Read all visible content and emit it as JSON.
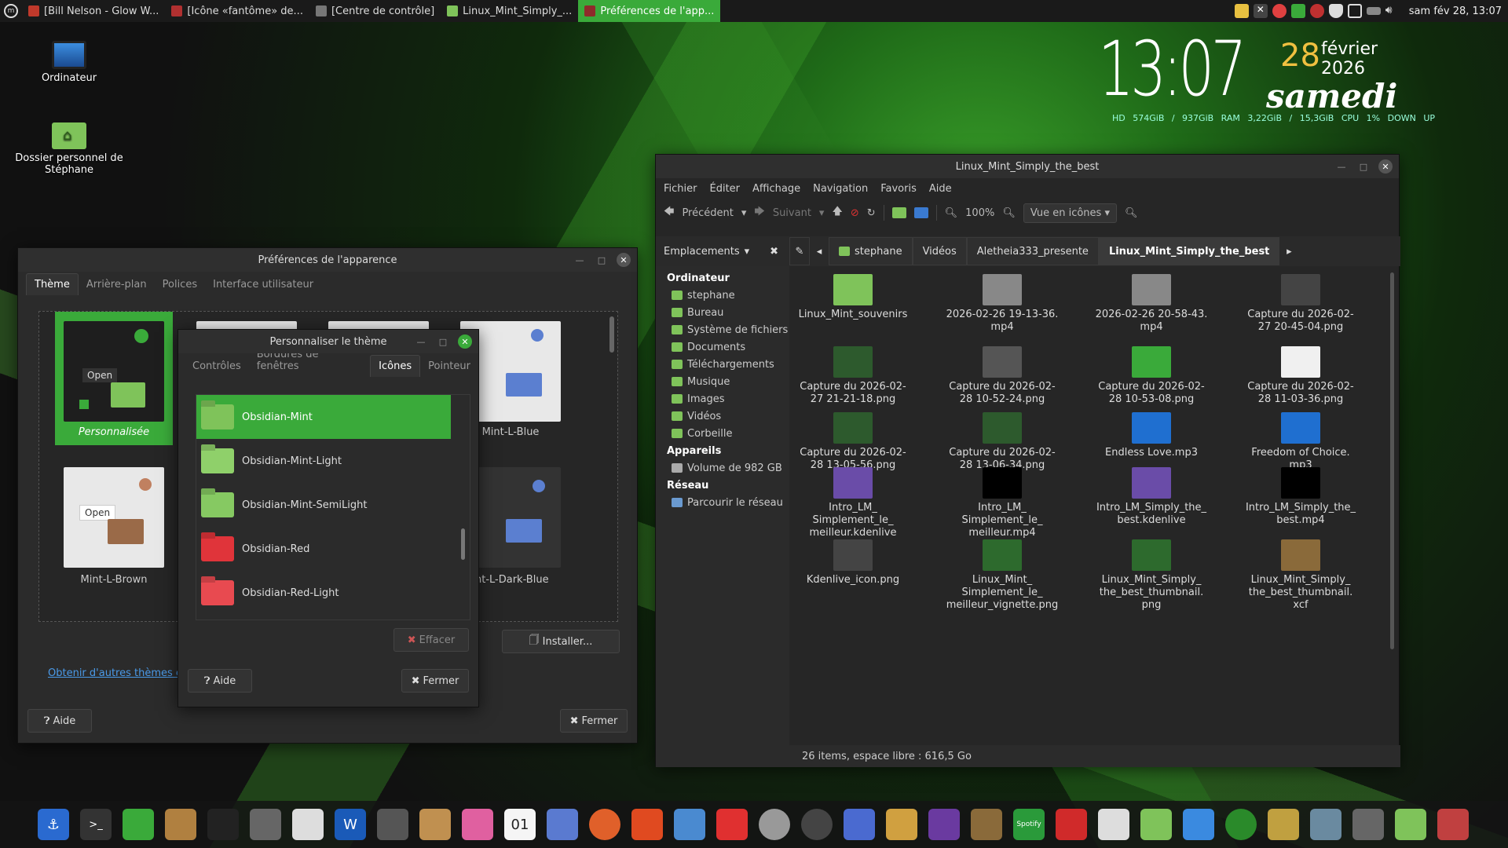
{
  "topbar": {
    "tasks": [
      {
        "label": "[Bill Nelson - Glow W...",
        "color": "#c0392b"
      },
      {
        "label": "[Icône «fantôme» de...",
        "color": "#b03030"
      },
      {
        "label": "[Centre de contrôle]",
        "color": "#777777"
      },
      {
        "label": "Linux_Mint_Simply_...",
        "color": "#7fc35a"
      },
      {
        "label": "Préférences de l'app...",
        "color": "#8e2b2b"
      }
    ],
    "clock": "sam fév 28, 13:07"
  },
  "desktop": {
    "icons": [
      {
        "label": "Ordinateur"
      },
      {
        "label": "Dossier personnel de Stéphane"
      }
    ]
  },
  "conky": {
    "time": "13:07",
    "day": "28",
    "month": "février 2026",
    "weekday": "samedi",
    "stats": "HD 574GiB / 937GiB   RAM 3,22GiB / 15,3GiB   CPU 1%   DOWN   UP"
  },
  "appearance": {
    "title": "Préférences de l'apparence",
    "tabs": [
      "Thème",
      "Arrière-plan",
      "Polices",
      "Interface utilisateur"
    ],
    "themes": [
      "Personnalisée",
      "Mint-L-Blue",
      "Mint-L-Brown",
      "int-L-Dark-Blue"
    ],
    "open_label": "Open",
    "install_label": "Installer...",
    "link_label": "Obtenir d'autres thèmes en",
    "help_label": "Aide",
    "close_label": "Fermer"
  },
  "theme_dialog": {
    "title": "Personnaliser le thème",
    "tabs": [
      "Contrôles",
      "Bordures de fenêtres",
      "Icônes",
      "Pointeur"
    ],
    "items": [
      {
        "label": "Obsidian-Mint",
        "color": "#7fc35a"
      },
      {
        "label": "Obsidian-Mint-Light",
        "color": "#8fd06a"
      },
      {
        "label": "Obsidian-Mint-SemiLight",
        "color": "#86c962"
      },
      {
        "label": "Obsidian-Red",
        "color": "#e0343a"
      },
      {
        "label": "Obsidian-Red-Light",
        "color": "#e84a50"
      }
    ],
    "clear_label": "Effacer",
    "help_label": "Aide",
    "close_label": "Fermer"
  },
  "filemanager": {
    "title": "Linux_Mint_Simply_the_best",
    "menu": [
      "Fichier",
      "Éditer",
      "Affichage",
      "Navigation",
      "Favoris",
      "Aide"
    ],
    "back_label": "Précédent",
    "forward_label": "Suivant",
    "zoom": "100%",
    "view_label": "Vue en icônes",
    "places_label": "Emplacements",
    "breadcrumbs": [
      "stephane",
      "Vidéos",
      "Aletheia333_presente",
      "Linux_Mint_Simply_the_best"
    ],
    "sidebar": {
      "computer_head": "Ordinateur",
      "computer": [
        "stephane",
        "Bureau",
        "Système de fichiers",
        "Documents",
        "Téléchargements",
        "Musique",
        "Images",
        "Vidéos",
        "Corbeille"
      ],
      "devices_head": "Appareils",
      "devices": [
        "Volume de 982 GB"
      ],
      "network_head": "Réseau",
      "network": [
        "Parcourir le réseau"
      ]
    },
    "files": [
      {
        "label": "Linux_Mint_souvenirs",
        "color": "#7fc35a"
      },
      {
        "label": "2026-02-26 19-13-36.\nmp4",
        "color": "#888888"
      },
      {
        "label": "2026-02-26 20-58-43.\nmp4",
        "color": "#888888"
      },
      {
        "label": "Capture du 2026-02-\n27 20-45-04.png",
        "color": "#444444"
      },
      {
        "label": "Capture du 2026-02-\n27 21-21-18.png",
        "color": "#2d5a2d"
      },
      {
        "label": "Capture du 2026-02-\n28 10-52-24.png",
        "color": "#555555"
      },
      {
        "label": "Capture du 2026-02-\n28 10-53-08.png",
        "color": "#3aaa3a"
      },
      {
        "label": "Capture du 2026-02-\n28 11-03-36.png",
        "color": "#f0f0f0"
      },
      {
        "label": "Capture du 2026-02-\n28 13-05-56.png",
        "color": "#2d5a2d"
      },
      {
        "label": "Capture du 2026-02-\n28 13-06-34.png",
        "color": "#2d5a2d"
      },
      {
        "label": "Endless Love.mp3",
        "color": "#1f6fd0"
      },
      {
        "label": "Freedom of Choice.\nmp3",
        "color": "#1f6fd0"
      },
      {
        "label": "Intro_LM_\nSimplement_le_\nmeilleur.kdenlive",
        "color": "#6a4ca8"
      },
      {
        "label": "Intro_LM_\nSimplement_le_\nmeilleur.mp4",
        "color": "#000000"
      },
      {
        "label": "Intro_LM_Simply_the_\nbest.kdenlive",
        "color": "#6a4ca8"
      },
      {
        "label": "Intro_LM_Simply_the_\nbest.mp4",
        "color": "#000000"
      },
      {
        "label": "Kdenlive_icon.png",
        "color": "#444444"
      },
      {
        "label": "Linux_Mint_\nSimplement_le_\nmeilleur_vignette.png",
        "color": "#2d6a2d"
      },
      {
        "label": "Linux_Mint_Simply_\nthe_best_thumbnail.\npng",
        "color": "#2d6a2d"
      },
      {
        "label": "Linux_Mint_Simply_\nthe_best_thumbnail.\nxcf",
        "color": "#8a6a3a"
      }
    ],
    "status": "26 items, espace libre : 616,5 Go"
  },
  "dock": {
    "icons": [
      "anchor-icon",
      "terminal-icon",
      "mintinstall-icon",
      "archive-icon",
      "camera-icon",
      "calculator-icon",
      "text-editor-icon",
      "writer-icon",
      "gimp-icon",
      "inkscape-icon",
      "draw-icon",
      "calendar-icon",
      "thunderbird-icon",
      "firefox-icon",
      "brave-icon",
      "feather-icon",
      "vivaldi-icon",
      "webcam-icon",
      "obs-icon",
      "teamviewer-icon",
      "clapper-icon",
      "audio-icon",
      "speaker-icon",
      "spotify-icon",
      "strawberry-icon",
      "cards-icon",
      "home-folder-icon",
      "window-icon",
      "green-circle-icon",
      "rhythmbox-icon",
      "recycle-icon",
      "mixer-icon",
      "home-icon",
      "gmail-icon"
    ],
    "calendar_day": "01",
    "spotify_label": "Spotify",
    "writer_label": "W"
  }
}
